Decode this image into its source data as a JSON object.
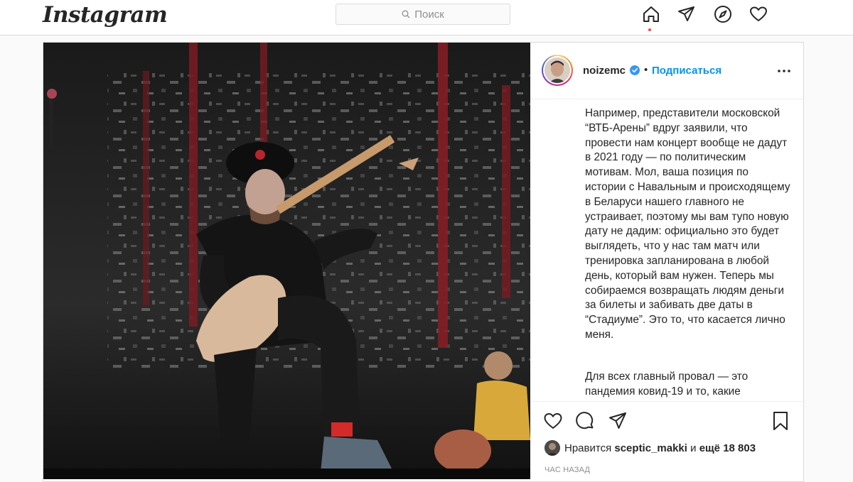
{
  "app": {
    "logo_text": "Instagram"
  },
  "search": {
    "placeholder": "Поиск"
  },
  "nav": {
    "icons": [
      "home-icon",
      "direct-icon",
      "explore-icon",
      "activity-icon"
    ]
  },
  "post": {
    "username": "noizemc",
    "separator": "•",
    "follow_label": "Подписаться",
    "caption_paragraphs": [
      "Например, представители московской “ВТБ-Арены” вдруг заявили, что провести нам концерт вообще не дадут в 2021 году — по политическим мотивам. Мол, ваша позиция по истории с Навальным и происходящему в Беларуси нашего главного не устраивает, поэтому мы вам тупо новую дату не дадим: официально это будет выглядеть, что у нас там матч или тренировка запланирована в любой день, который вам нужен. Теперь мы собираемся возвращать людям деньги за билеты и забивать две даты в “Стадиуме”. Это то, что касается лично меня.",
      "Для всех главный провал — это пандемия ковид-19 и то, какие"
    ],
    "likes": {
      "prefix": "Нравится",
      "user": "sceptic_makki",
      "conj": "и",
      "rest": "ещё 18 803"
    },
    "timestamp": "ЧАС НАЗАД"
  },
  "colors": {
    "accent": "#0095f6",
    "notification_dot": "#ed4956",
    "border": "#dbdbdb"
  }
}
